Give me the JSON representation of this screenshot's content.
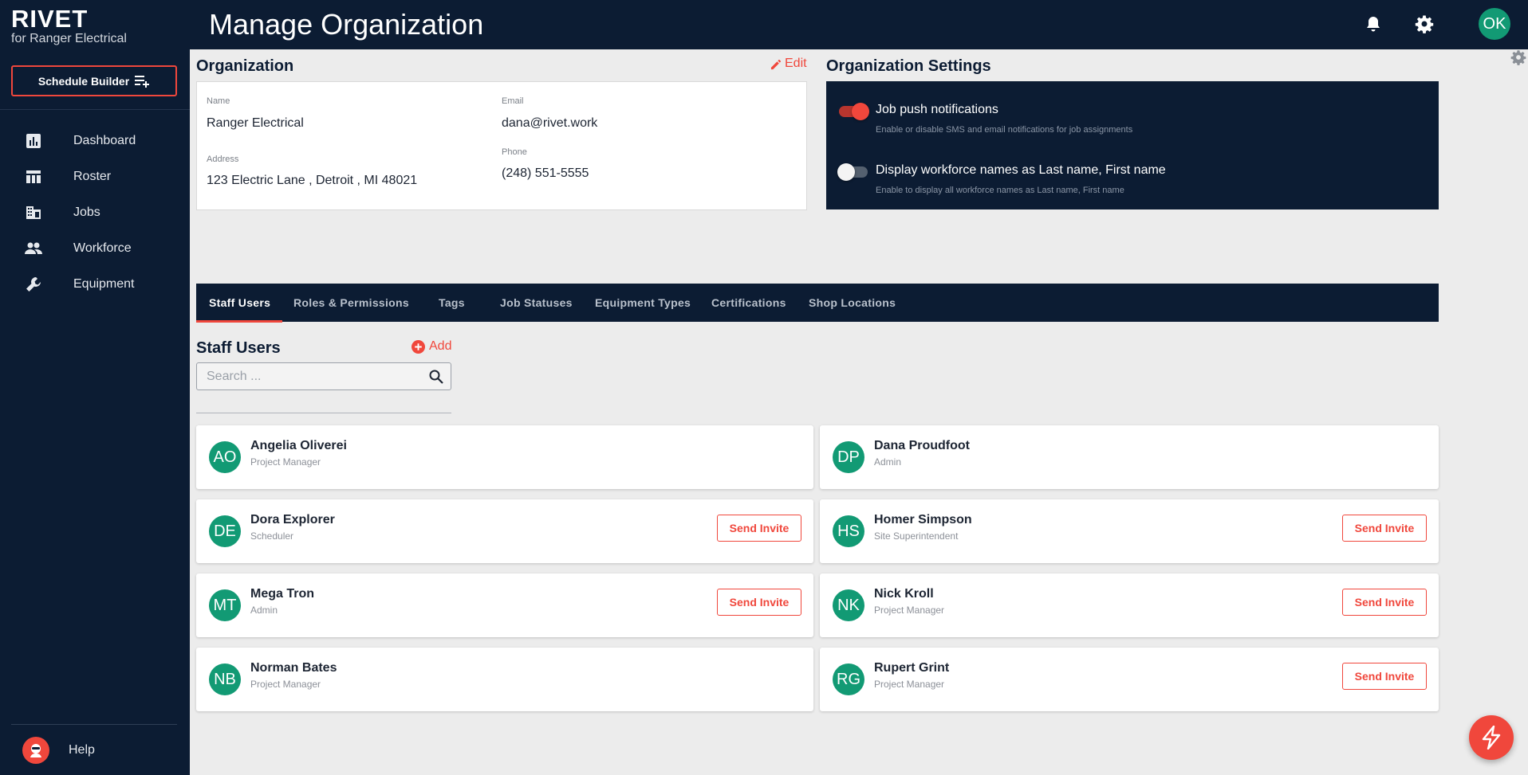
{
  "brand": {
    "name": "RIVET",
    "subtitle": "for Ranger Electrical"
  },
  "sidebar": {
    "schedule_button": "Schedule Builder",
    "items": [
      {
        "label": "Dashboard",
        "icon": "chart-bar-icon"
      },
      {
        "label": "Roster",
        "icon": "table-icon"
      },
      {
        "label": "Jobs",
        "icon": "building-icon"
      },
      {
        "label": "Workforce",
        "icon": "people-icon"
      },
      {
        "label": "Equipment",
        "icon": "wrench-icon"
      }
    ],
    "help_label": "Help"
  },
  "header": {
    "title": "Manage Organization",
    "avatar_initials": "OK"
  },
  "organization": {
    "title": "Organization",
    "edit_label": "Edit",
    "name_label": "Name",
    "name": "Ranger Electrical",
    "email_label": "Email",
    "email": "dana@rivet.work",
    "address_label": "Address",
    "address": "123 Electric Lane , Detroit , MI 48021",
    "phone_label": "Phone",
    "phone": "(248) 551-5555"
  },
  "settings": {
    "title": "Organization Settings",
    "items": [
      {
        "label": "Job push notifications",
        "description": "Enable or disable SMS and email notifications for job assignments",
        "enabled": true
      },
      {
        "label": "Display workforce names as Last name, First name",
        "description": "Enable to display all workforce names as Last name, First name",
        "enabled": false
      }
    ]
  },
  "tabs": [
    "Staff Users",
    "Roles & Permissions",
    "Tags",
    "Job Statuses",
    "Equipment Types",
    "Certifications",
    "Shop Locations"
  ],
  "staff": {
    "title": "Staff Users",
    "add_label": "Add",
    "search_placeholder": "Search ...",
    "invite_label": "Send Invite",
    "users": [
      {
        "initials": "AO",
        "name": "Angelia Oliverei",
        "role": "Project Manager",
        "invite": false
      },
      {
        "initials": "DP",
        "name": "Dana Proudfoot",
        "role": "Admin",
        "invite": false
      },
      {
        "initials": "DE",
        "name": "Dora Explorer",
        "role": "Scheduler",
        "invite": true
      },
      {
        "initials": "HS",
        "name": "Homer Simpson",
        "role": "Site Superintendent",
        "invite": true
      },
      {
        "initials": "MT",
        "name": "Mega Tron",
        "role": "Admin",
        "invite": true
      },
      {
        "initials": "NK",
        "name": "Nick Kroll",
        "role": "Project Manager",
        "invite": true
      },
      {
        "initials": "NB",
        "name": "Norman Bates",
        "role": "Project Manager",
        "invite": false
      },
      {
        "initials": "RG",
        "name": "Rupert Grint",
        "role": "Project Manager",
        "invite": true
      }
    ]
  },
  "colors": {
    "navy": "#0c1c33",
    "accent": "#f0473c",
    "avatar": "#129a74"
  }
}
